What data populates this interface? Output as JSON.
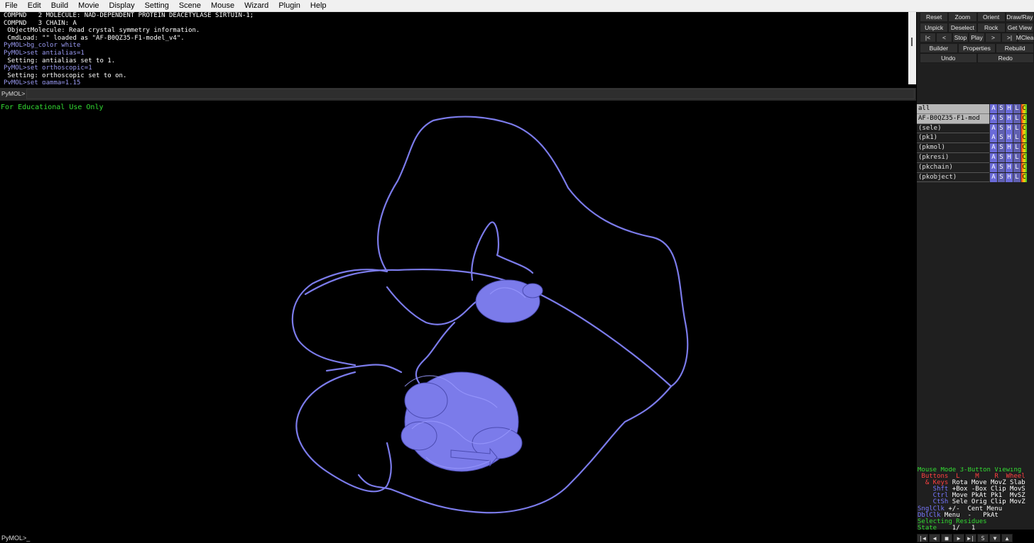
{
  "menu": [
    "File",
    "Edit",
    "Build",
    "Movie",
    "Display",
    "Setting",
    "Scene",
    "Mouse",
    "Wizard",
    "Plugin",
    "Help"
  ],
  "log_lines": [
    {
      "text": "COMPND   2 MOLECULE: NAD-DEPENDENT PROTEIN DEACETYLASE SIRTUIN-1;",
      "type": "out"
    },
    {
      "text": "COMPND   3 CHAIN: A",
      "type": "out"
    },
    {
      "text": " ObjectMolecule: Read crystal symmetry information.",
      "type": "out"
    },
    {
      "text": " CmdLoad: \"\" loaded as \"AF-B0QZ35-F1-model_v4\".",
      "type": "out"
    },
    {
      "text": "PyMOL>bg_color white",
      "type": "cmd"
    },
    {
      "text": "PyMOL>set antialias=1",
      "type": "cmd"
    },
    {
      "text": " Setting: antialias set to 1.",
      "type": "out"
    },
    {
      "text": "PyMOL>set orthoscopic=1",
      "type": "cmd"
    },
    {
      "text": " Setting: orthoscopic set to on.",
      "type": "out"
    },
    {
      "text": "PyMOL>set gamma=1.15",
      "type": "cmd"
    }
  ],
  "buttons": [
    [
      "Reset",
      "Zoom",
      "Orient",
      "Draw/Ray"
    ],
    [
      "Unpick",
      "Deselect",
      "Rock",
      "Get View"
    ],
    [
      "|<",
      "<",
      "Stop",
      "Play",
      ">",
      ">|",
      "MClear"
    ],
    [
      "Builder",
      "Properties",
      "Rebuild"
    ],
    [
      "Undo",
      "Redo"
    ]
  ],
  "command_prompt": "PyMOL>",
  "bottom_prompt": "PyMOL>_",
  "watermark": "For Educational Use Only",
  "objects": [
    {
      "name": "all",
      "selected": true
    },
    {
      "name": "AF-B0QZ35-F1-mod",
      "selected": true
    },
    {
      "name": "(sele)",
      "selected": false
    },
    {
      "name": "(pk1)",
      "selected": false
    },
    {
      "name": "(pkmol)",
      "selected": false
    },
    {
      "name": "(pkresi)",
      "selected": false
    },
    {
      "name": "(pkchain)",
      "selected": false
    },
    {
      "name": "(pkobject)",
      "selected": false
    }
  ],
  "object_buttons": [
    "A",
    "S",
    "H",
    "L",
    "C"
  ],
  "mouse_help": {
    "title": "Mouse Mode 3-Button Viewing",
    "header": " Buttons  L    M    R  Wheel",
    "keys_label": "  & Keys",
    "rows": [
      {
        "key": "  & Keys",
        "vals": " Rota Move MovZ Slab"
      },
      {
        "key": "    Shft",
        "vals": " +Box -Box Clip MovS"
      },
      {
        "key": "    Ctrl",
        "vals": " Move PkAt Pk1  MvSZ"
      },
      {
        "key": "    CtSh",
        "vals": " Sele Orig Clip MovZ"
      },
      {
        "key": "SnglClk",
        "vals": " +/-  Cent Menu"
      },
      {
        "key": "DblClk",
        "vals": " Menu  -   PkAt"
      }
    ],
    "selecting": "Selecting Residues",
    "state_label": "State",
    "state_value": "1/   1"
  },
  "state_buttons": [
    "|◀",
    "◀",
    "■",
    "▶",
    "▶|",
    "S",
    "▼",
    "▲"
  ],
  "colors": {
    "ribbon": "#7b7bea",
    "background": "#000000",
    "panel": "#1f1f1f"
  }
}
